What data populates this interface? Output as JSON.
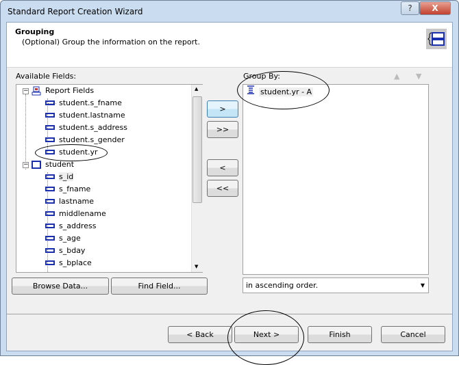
{
  "window": {
    "title": "Standard Report Creation Wizard",
    "help": "?",
    "close": "X"
  },
  "header": {
    "title": "Grouping",
    "subtitle": "(Optional) Group the information on the report.",
    "icon": "grouping-icon"
  },
  "available": {
    "label": "Available Fields:",
    "groups": [
      {
        "label": "Report Fields",
        "icon": "report-fields-icon",
        "items": [
          "student.s_fname",
          "student.lastname",
          "student.s_address",
          "student.s_gender",
          "student.yr"
        ]
      },
      {
        "label": "student",
        "icon": "table-icon",
        "items": [
          "s_id",
          "s_fname",
          "lastname",
          "middlename",
          "s_address",
          "s_age",
          "s_bday",
          "s_bplace"
        ]
      }
    ]
  },
  "transfer": {
    "add": ">",
    "add_all": ">>",
    "remove": "<",
    "remove_all": "<<"
  },
  "group_by": {
    "label": "Group By:",
    "items": [
      "student.yr - A"
    ]
  },
  "order": {
    "value": "in ascending order."
  },
  "buttons": {
    "browse": "Browse Data...",
    "find": "Find Field...",
    "back": "< Back",
    "next": "Next >",
    "finish": "Finish",
    "cancel": "Cancel"
  }
}
